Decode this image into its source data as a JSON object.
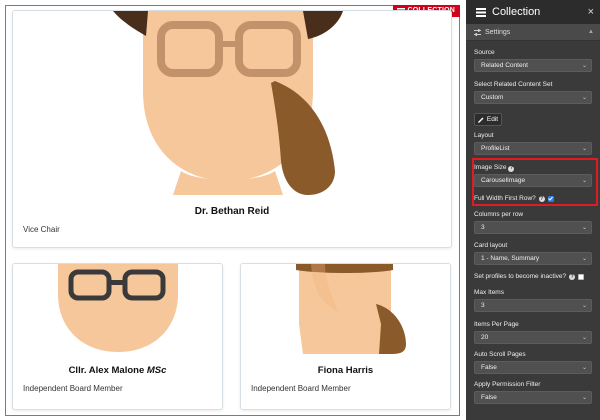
{
  "collection_tag": "COLLECTION",
  "cards": [
    {
      "name": "Dr. Bethan Reid",
      "role": "Vice Chair"
    },
    {
      "name_main": "Cllr. Alex Malone ",
      "name_suffix": "MSc",
      "role": "Independent Board Member"
    },
    {
      "name": "Fiona Harris",
      "role": "Independent Board Member"
    }
  ],
  "panel": {
    "title": "Collection",
    "close": "×",
    "settings_label": "Settings",
    "source": {
      "label": "Source",
      "value": "Related Content"
    },
    "related_set": {
      "label": "Select Related Content Set",
      "value": "Custom"
    },
    "edit_button": "Edit",
    "layout": {
      "label": "Layout",
      "value": "ProfileList"
    },
    "image_size": {
      "label": "Image Size",
      "value": "CarouselImage"
    },
    "full_width": {
      "label": "Full Width First Row?",
      "checked": true
    },
    "columns": {
      "label": "Columns per row",
      "value": "3"
    },
    "card_layout": {
      "label": "Card layout",
      "value": "1 - Name, Summary"
    },
    "inactive": {
      "label": "Set profiles to become inactive?",
      "checked": false
    },
    "max_items": {
      "label": "Max Items",
      "value": "3"
    },
    "items_per_page": {
      "label": "Items Per Page",
      "value": "20"
    },
    "auto_scroll": {
      "label": "Auto Scroll Pages",
      "value": "False"
    },
    "permission_filter": {
      "label": "Apply Permission Filter",
      "value": "False"
    }
  },
  "colors": {
    "accent_red": "#e01b24",
    "panel_bg": "#3a3a3a",
    "checkbox_blue": "#2a7ae2",
    "skin": "#f6c79a",
    "hair_brown": "#8a5a2b",
    "hair_dark": "#4a2e1c",
    "glasses": "#c4926a"
  }
}
